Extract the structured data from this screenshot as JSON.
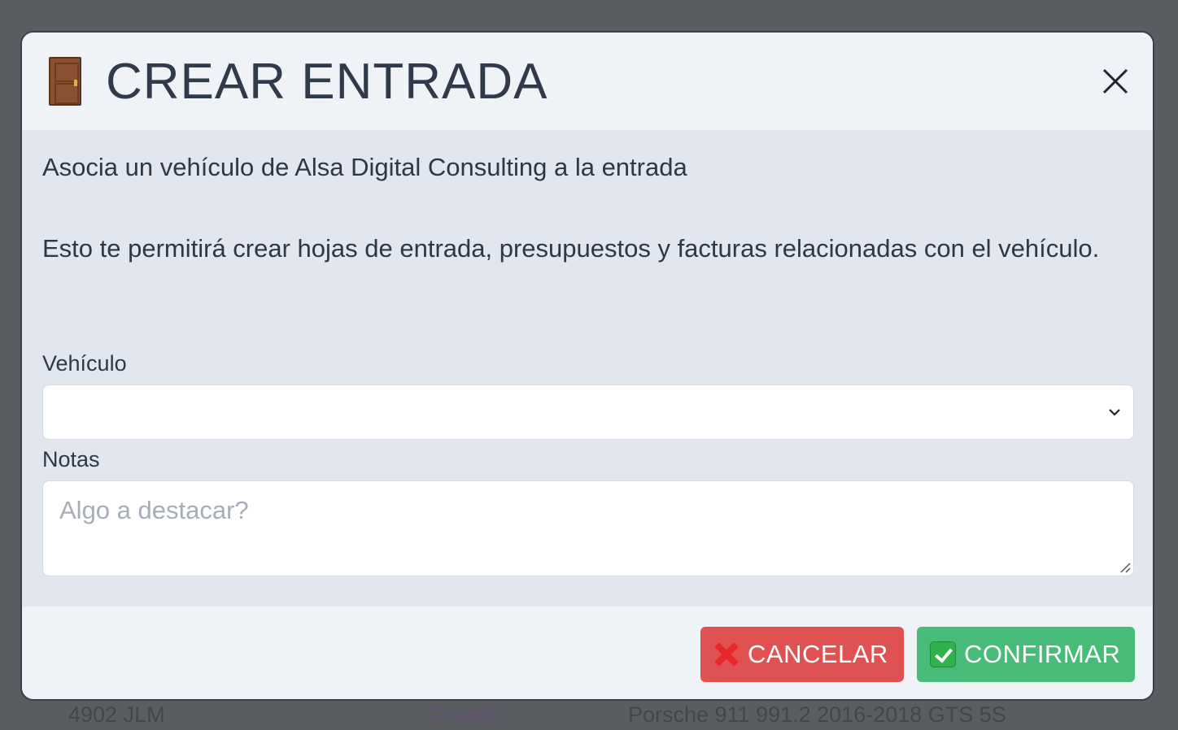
{
  "background": {
    "row_plate": "4902 JLM",
    "row_status": "Creado",
    "row_vehicle": "Porsche 911 991.2 2016-2018 GTS 5S"
  },
  "modal": {
    "icon": "door-icon",
    "title": "CREAR ENTRADA",
    "close_icon": "close-icon",
    "intro": "Asocia un vehículo de Alsa Digital Consulting a la entrada",
    "description": "Esto te permitirá crear hojas de entrada, presupuestos y facturas relacionadas con el vehículo.",
    "vehicle_label": "Vehículo",
    "vehicle_value": "",
    "notes_label": "Notas",
    "notes_placeholder": "Algo a destacar?",
    "cancel_label": "CANCELAR",
    "confirm_label": "CONFIRMAR"
  },
  "colors": {
    "cancel": "#e05252",
    "confirm": "#48bb78",
    "overlay": "#5a5d61"
  }
}
